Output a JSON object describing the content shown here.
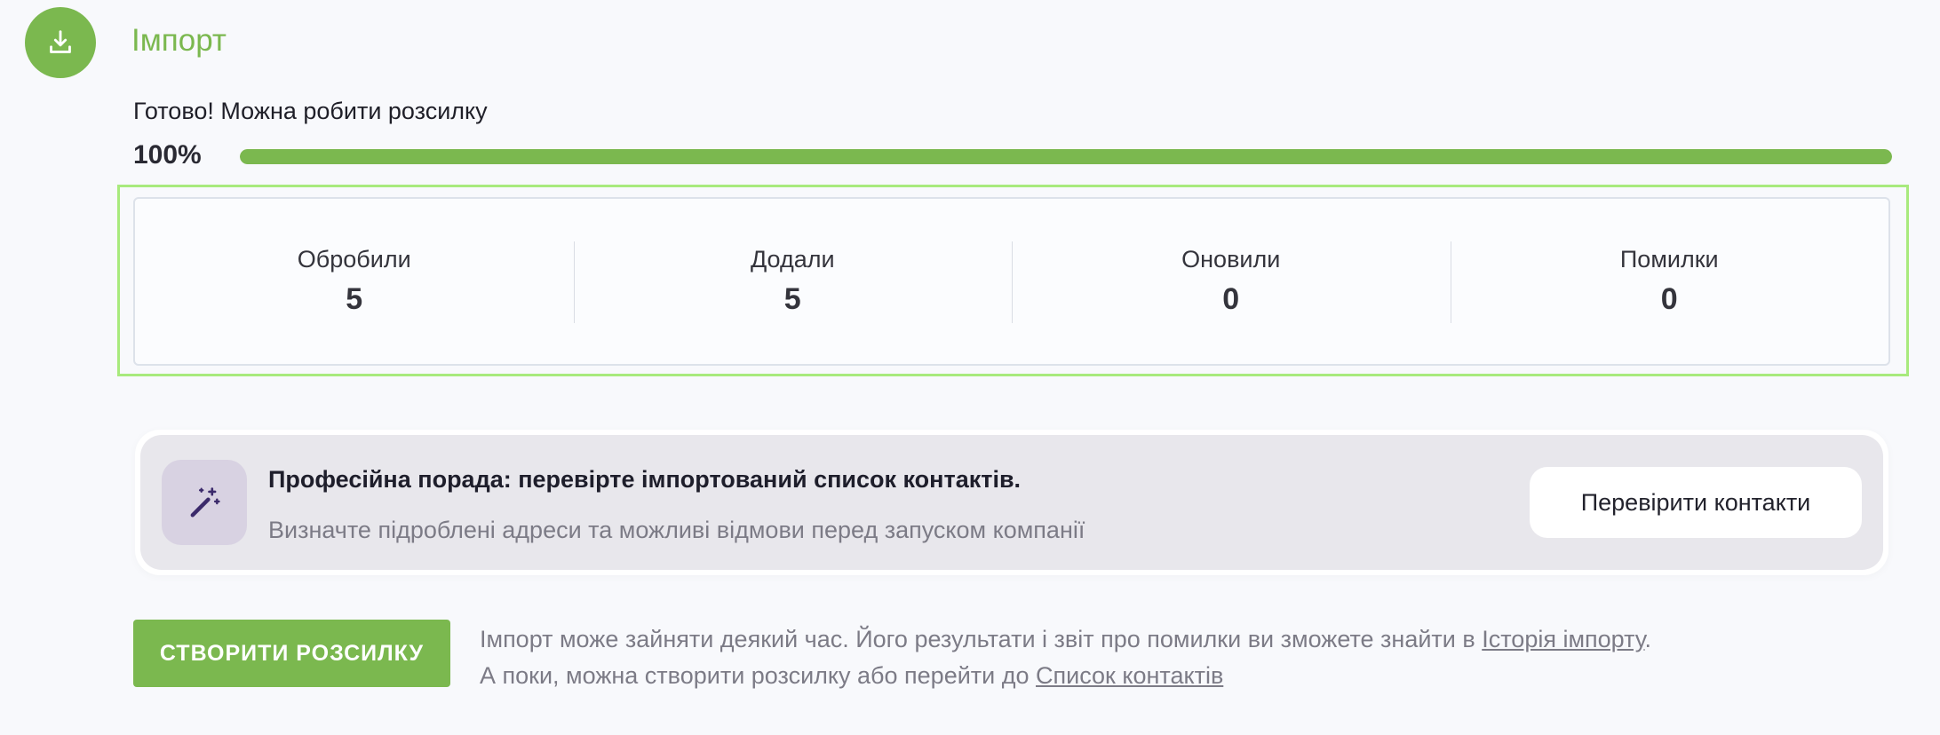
{
  "header": {
    "title": "Імпорт",
    "icon": "download-icon",
    "accent_color": "#7bb84f"
  },
  "progress": {
    "status_text": "Готово! Можна робити розсилку",
    "percent_label": "100%",
    "value": 1.0
  },
  "stats": [
    {
      "label": "Обробили",
      "value": "5"
    },
    {
      "label": "Додали",
      "value": "5"
    },
    {
      "label": "Оновили",
      "value": "0"
    },
    {
      "label": "Помилки",
      "value": "0"
    }
  ],
  "tip": {
    "icon": "magic-wand-icon",
    "title": "Професійна порада: перевірте імпортований список контактів.",
    "description": "Визначте підроблені адреси та можливі відмови перед запуском компанії",
    "button_label": "Перевірити контакти"
  },
  "footer": {
    "create_button_label": "СТВОРИТИ РОЗСИЛКУ",
    "line1_text": "Імпорт може зайняти деякий час. Його результати і звіт про помилки ви зможете знайти в ",
    "line1_link": "Історія імпорту",
    "line1_end": ".",
    "line2_text": "А поки, можна створити розсилку або перейти до ",
    "line2_link": "Список контактів"
  }
}
